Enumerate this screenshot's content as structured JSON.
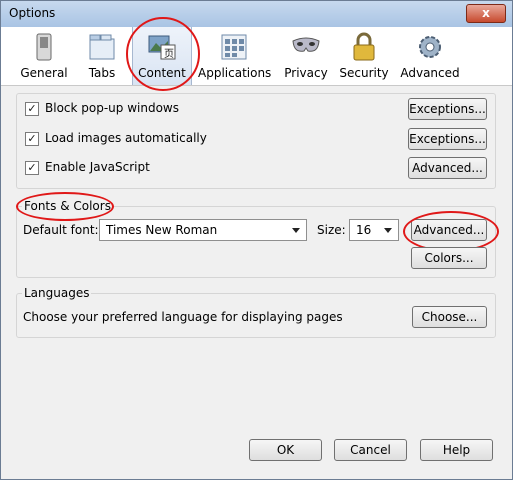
{
  "window": {
    "title": "Options",
    "close_glyph": "x"
  },
  "toolbar": {
    "items": [
      {
        "label": "General",
        "icon": "switch-icon"
      },
      {
        "label": "Tabs",
        "icon": "tabs-icon"
      },
      {
        "label": "Content",
        "icon": "content-icon",
        "selected": true
      },
      {
        "label": "Applications",
        "icon": "applications-icon"
      },
      {
        "label": "Privacy",
        "icon": "privacy-mask-icon"
      },
      {
        "label": "Security",
        "icon": "padlock-icon"
      },
      {
        "label": "Advanced",
        "icon": "gear-icon"
      }
    ]
  },
  "content": {
    "checkboxes": [
      {
        "label": "Block pop-up windows",
        "checked": true
      },
      {
        "label": "Load images automatically",
        "checked": true
      },
      {
        "label": "Enable JavaScript",
        "checked": true
      }
    ],
    "buttons": {
      "exceptions_1": "Exceptions...",
      "exceptions_2": "Exceptions...",
      "advanced_js": "Advanced..."
    }
  },
  "fonts_colors": {
    "group_label": "Fonts & Colors",
    "default_font_label": "Default font:",
    "default_font_value": "Times New Roman",
    "size_label": "Size:",
    "size_value": "16",
    "advanced_button": "Advanced...",
    "colors_button": "Colors..."
  },
  "languages": {
    "group_label": "Languages",
    "description": "Choose your preferred language for displaying pages",
    "choose_button": "Choose..."
  },
  "footer": {
    "ok": "OK",
    "cancel": "Cancel",
    "help": "Help"
  },
  "colors": {
    "annotation_red": "#e01818",
    "selected_tab_bg": "#d9e4f3"
  }
}
